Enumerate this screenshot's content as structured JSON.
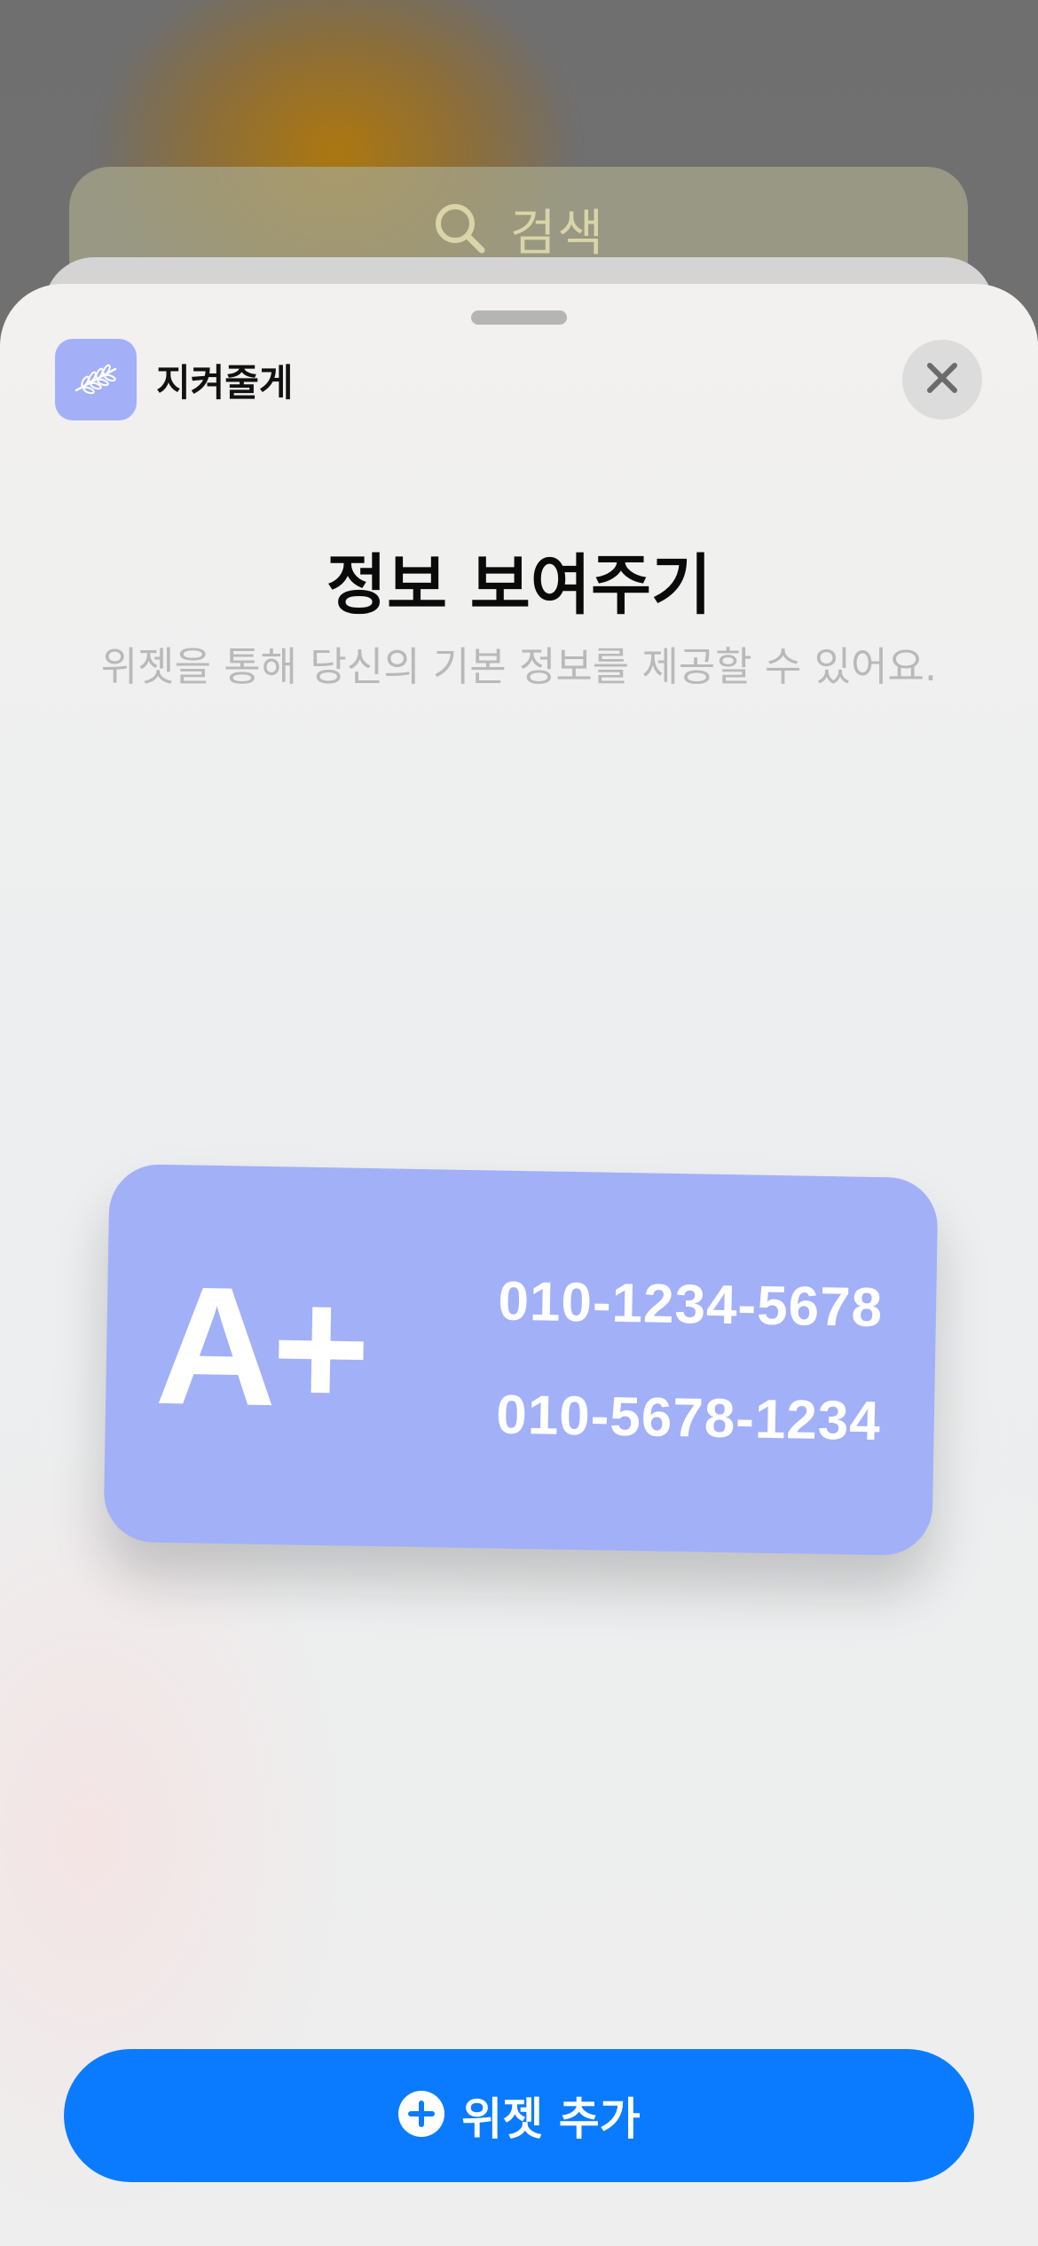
{
  "search": {
    "label": "검색",
    "icon": "search-icon"
  },
  "app": {
    "name": "지켜줄게",
    "icon": "leaf-branch-icon",
    "accent_color": "#a3b0f8"
  },
  "close": {
    "icon": "close-icon"
  },
  "gallery": {
    "title": "정보 보여주기",
    "subtitle": "위젯을 통해 당신의 기본 정보를 제공할 수 있어요."
  },
  "widget": {
    "blood_type": "A+",
    "phone_1": "010-1234-5678",
    "phone_2": "010-5678-1234",
    "background_color": "#a2b0f8"
  },
  "add_button": {
    "label": "위젯 추가",
    "icon": "plus-circle-icon",
    "color": "#0a7bff"
  }
}
